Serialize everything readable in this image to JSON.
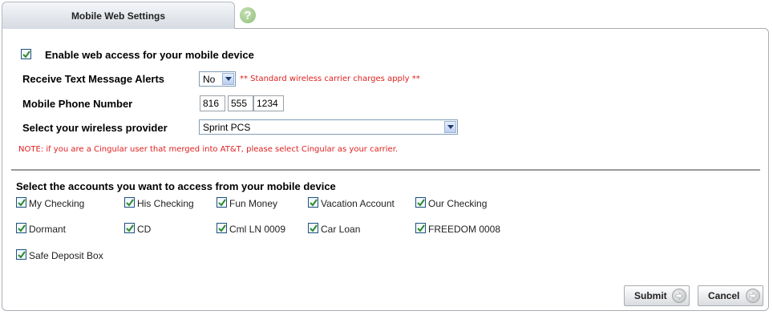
{
  "tab": {
    "title": "Mobile Web Settings"
  },
  "help": {
    "glyph": "?"
  },
  "settings": {
    "enable_label": "Enable web access for your mobile device",
    "alerts_label": "Receive Text Message Alerts",
    "alerts_value": "No",
    "charges_note": "** Standard wireless carrier charges apply **",
    "phone_label": "Mobile Phone Number",
    "phone_area": "816",
    "phone_prefix": "555",
    "phone_line": "1234",
    "provider_label": "Select your wireless provider",
    "provider_value": "Sprint PCS",
    "cingular_note": "NOTE: if you are a Cingular user that merged into AT&T, please select Cingular as your carrier."
  },
  "accounts": {
    "heading": "Select the accounts you want to access from your mobile device",
    "items": [
      {
        "label": "My Checking",
        "checked": true
      },
      {
        "label": "His Checking",
        "checked": true
      },
      {
        "label": "Fun Money",
        "checked": true
      },
      {
        "label": "Vacation Account",
        "checked": true
      },
      {
        "label": "Our Checking",
        "checked": true
      },
      {
        "label": "Dormant",
        "checked": true
      },
      {
        "label": "CD",
        "checked": true
      },
      {
        "label": "Cml LN 0009",
        "checked": true
      },
      {
        "label": "Car Loan",
        "checked": true
      },
      {
        "label": "FREEDOM 0008",
        "checked": true
      },
      {
        "label": "Safe Deposit Box",
        "checked": true
      }
    ]
  },
  "buttons": {
    "submit": "Submit",
    "cancel": "Cancel"
  },
  "colors": {
    "checkmark": "#2b8a2b",
    "note_red": "#e02020"
  }
}
